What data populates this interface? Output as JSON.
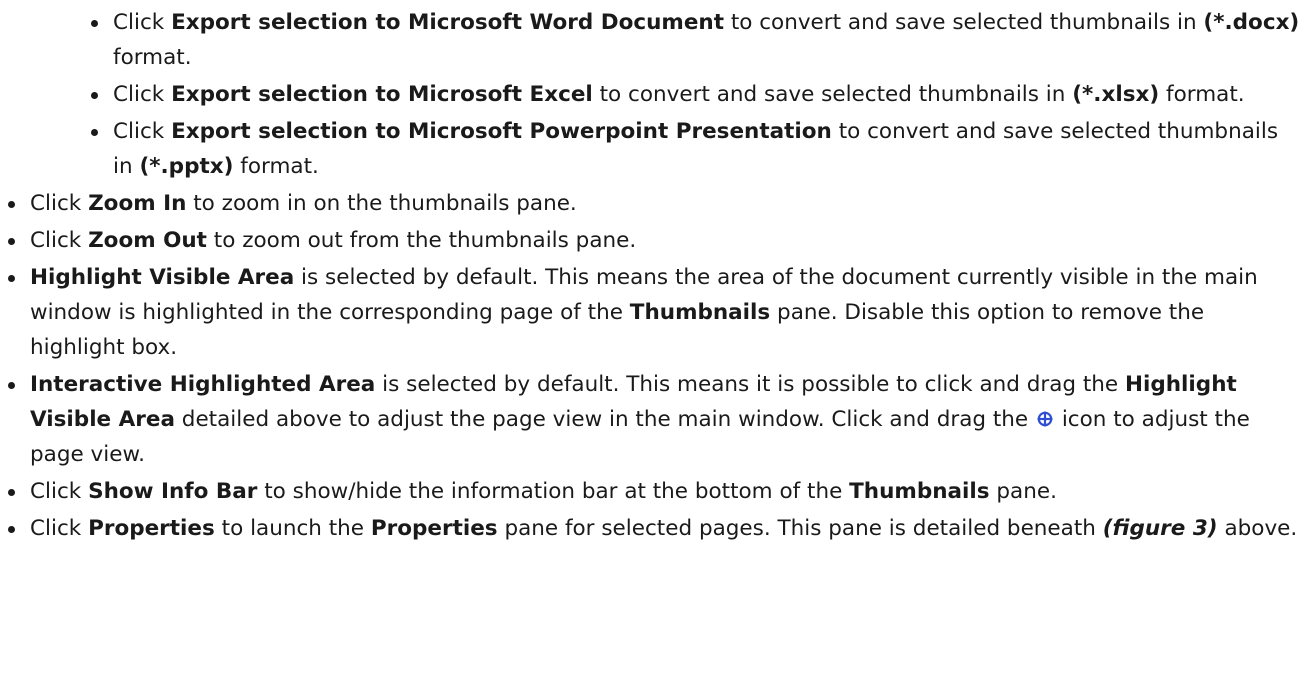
{
  "sub_items": [
    {
      "pre": "Click ",
      "bold": "Export selection to Microsoft Word Document",
      "mid": " to convert and save selected thumbnails in ",
      "bold2": "(*.docx)",
      "post": " format."
    },
    {
      "pre": "Click ",
      "bold": "Export selection to Microsoft Excel",
      "mid": " to convert and save selected thumbnails in ",
      "bold2": "(*.xlsx)",
      "post": " format."
    },
    {
      "pre": "Click ",
      "bold": "Export selection to Microsoft Powerpoint Presentation",
      "mid": " to convert and save selected thumbnails in ",
      "bold2": "(*.pptx)",
      "post": " format."
    }
  ],
  "items": {
    "zoom_in": {
      "pre": "Click ",
      "bold": "Zoom In",
      "post": " to zoom in on the thumbnails pane."
    },
    "zoom_out": {
      "pre": "Click ",
      "bold": "Zoom Out",
      "post": " to zoom out from the thumbnails pane."
    },
    "highlight_visible": {
      "bold": "Highlight Visible Area",
      "mid": " is selected by default. This means the area of the document currently visible in the main window is highlighted in the corresponding page of the ",
      "bold2": "Thumbnails",
      "post": " pane. Disable this option to remove the highlight box."
    },
    "interactive_highlight": {
      "bold": "Interactive Highlighted Area",
      "mid": " is selected by default. This means it is possible to click and drag the ",
      "bold2": "Highlight Visible Area",
      "mid2": " detailed above to adjust the page view in the main window. Click and drag the ",
      "icon": "crosshair-move-icon",
      "post": " icon to adjust the page view."
    },
    "show_info_bar": {
      "pre": "Click ",
      "bold": "Show Info Bar",
      "mid": " to show/hide the information bar at the bottom of the ",
      "bold2": "Thumbnails",
      "post": " pane."
    },
    "properties": {
      "pre": "Click ",
      "bold": "Properties",
      "mid": " to launch the ",
      "bold2": "Properties",
      "mid2": " pane for selected pages. This pane is detailed beneath ",
      "bold_italic": "(figure 3)",
      "post": " above."
    }
  },
  "colors": {
    "text": "#1a1a1a",
    "icon": "#2f4fd0"
  }
}
